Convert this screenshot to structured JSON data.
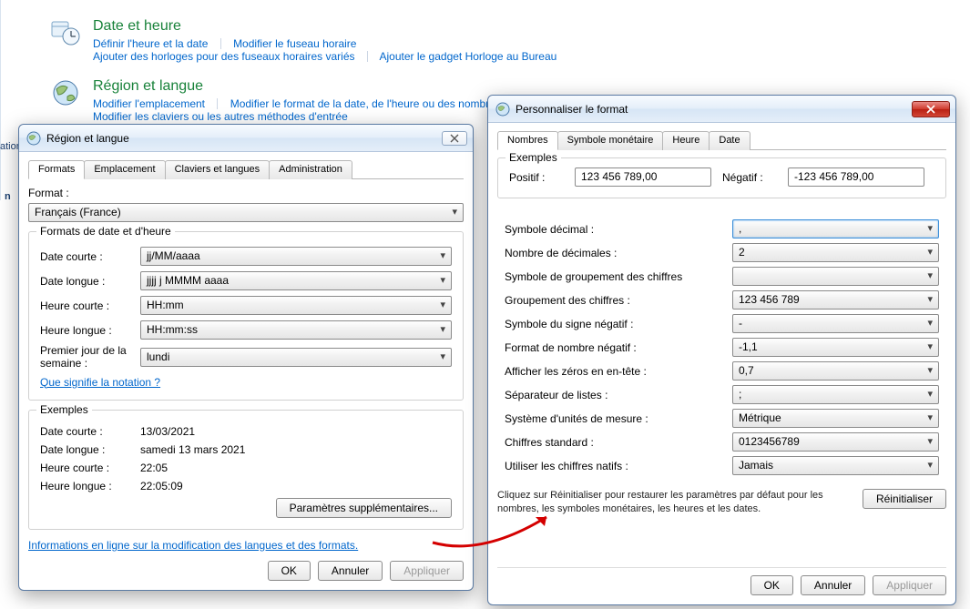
{
  "cp": {
    "side_frag": "ation",
    "side_sel": "n",
    "datetime": {
      "title": "Date et heure",
      "links": [
        "Définir l'heure et la date",
        "Modifier le fuseau horaire",
        "Ajouter des horloges pour des fuseaux horaires variés",
        "Ajouter le gadget Horloge au Bureau"
      ]
    },
    "region": {
      "title": "Région et langue",
      "links": [
        "Modifier l'emplacement",
        "Modifier le format de la date, de l'heure ou des nombres",
        "Modifier les claviers ou les autres méthodes d'entrée"
      ]
    }
  },
  "winRegion": {
    "title": "Région et langue",
    "tabs": [
      "Formats",
      "Emplacement",
      "Claviers et langues",
      "Administration"
    ],
    "format_label": "Format :",
    "format_value": "Français (France)",
    "group_dt_title": "Formats de date et d'heure",
    "dt_rows": {
      "short_date_k": "Date courte :",
      "short_date_v": "jj/MM/aaaa",
      "long_date_k": "Date longue :",
      "long_date_v": "jjjj j MMMM aaaa",
      "short_time_k": "Heure courte :",
      "short_time_v": "HH:mm",
      "long_time_k": "Heure longue :",
      "long_time_v": "HH:mm:ss",
      "first_day_k": "Premier jour de la semaine :",
      "first_day_v": "lundi"
    },
    "notation_link": "Que signifie la notation ?",
    "group_ex_title": "Exemples",
    "ex_rows": {
      "short_date_k": "Date courte :",
      "short_date_v": "13/03/2021",
      "long_date_k": "Date longue :",
      "long_date_v": "samedi 13 mars 2021",
      "short_time_k": "Heure courte :",
      "short_time_v": "22:05",
      "long_time_k": "Heure longue :",
      "long_time_v": "22:05:09"
    },
    "more_params_btn": "Paramètres supplémentaires...",
    "online_link": "Informations en ligne sur la modification des langues et des formats.",
    "ok": "OK",
    "cancel": "Annuler",
    "apply": "Appliquer"
  },
  "winCustom": {
    "title": "Personnaliser le format",
    "tabs": [
      "Nombres",
      "Symbole monétaire",
      "Heure",
      "Date"
    ],
    "ex_title": "Exemples",
    "pos_label": "Positif :",
    "pos_val": "123 456 789,00",
    "neg_label": "Négatif :",
    "neg_val": "-123 456 789,00",
    "rows": {
      "decimal": {
        "k": "Symbole décimal :",
        "v": ","
      },
      "ndec": {
        "k": "Nombre de décimales :",
        "v": "2"
      },
      "grouping_sym": {
        "k": "Symbole de groupement des chiffres",
        "v": ""
      },
      "grouping": {
        "k": "Groupement des chiffres :",
        "v": "123 456 789"
      },
      "neg_sym": {
        "k": "Symbole du signe négatif :",
        "v": "-"
      },
      "neg_fmt": {
        "k": "Format de nombre négatif :",
        "v": "-1,1"
      },
      "lead_zero": {
        "k": "Afficher les zéros en en-tête :",
        "v": "0,7"
      },
      "list_sep": {
        "k": "Séparateur de listes :",
        "v": ";"
      },
      "units": {
        "k": "Système d'unités de mesure :",
        "v": "Métrique"
      },
      "std_digits": {
        "k": "Chiffres standard :",
        "v": "0123456789"
      },
      "native_digits": {
        "k": "Utiliser les chiffres natifs :",
        "v": "Jamais"
      }
    },
    "help": "Cliquez sur Réinitialiser pour restaurer les paramètres par défaut pour les nombres, les symboles monétaires, les heures et les dates.",
    "reset": "Réinitialiser",
    "ok": "OK",
    "cancel": "Annuler",
    "apply": "Appliquer"
  }
}
